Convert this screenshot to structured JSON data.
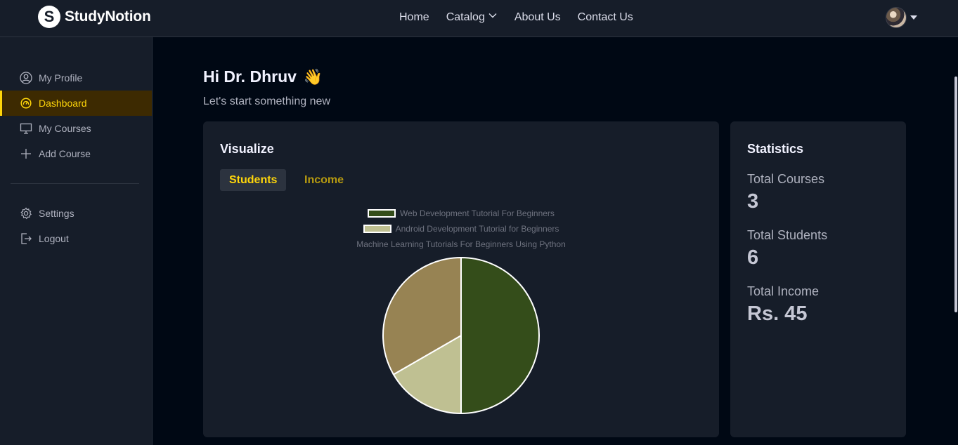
{
  "brand": {
    "name": "StudyNotion",
    "mark": "S"
  },
  "nav": {
    "links": [
      {
        "label": "Home"
      },
      {
        "label": "Catalog"
      },
      {
        "label": "About Us"
      },
      {
        "label": "Contact Us"
      }
    ]
  },
  "sidebar": {
    "items": [
      {
        "label": "My Profile",
        "icon": "user-circle-icon"
      },
      {
        "label": "Dashboard",
        "icon": "dashboard-gauge-icon",
        "active": true
      },
      {
        "label": "My Courses",
        "icon": "monitor-icon"
      },
      {
        "label": "Add Course",
        "icon": "plus-icon"
      }
    ],
    "bottom_items": [
      {
        "label": "Settings",
        "icon": "gear-icon"
      },
      {
        "label": "Logout",
        "icon": "logout-icon"
      }
    ]
  },
  "main": {
    "greeting": "Hi Dr. Dhruv",
    "greeting_emoji": "👋",
    "subtitle": "Let's start something new"
  },
  "visualize": {
    "title": "Visualize",
    "tabs": [
      {
        "label": "Students",
        "active": true
      },
      {
        "label": "Income",
        "active": false
      }
    ]
  },
  "chart_data": {
    "type": "pie",
    "title": "",
    "categories": [
      "Web Development Tutorial For Beginners",
      "Android Development Tutorial for Beginners",
      "Machine Learning Tutorials For Beginners Using Python"
    ],
    "values": [
      3,
      1,
      2
    ],
    "colors": [
      "#344d1a",
      "#bfc092",
      "#978353"
    ],
    "legend": "top-center"
  },
  "statistics": {
    "title": "Statistics",
    "items": [
      {
        "label": "Total Courses",
        "value": "3"
      },
      {
        "label": "Total Students",
        "value": "6"
      },
      {
        "label": "Total Income",
        "value": "Rs. 45"
      }
    ]
  },
  "colors": {
    "accent": "#ffd60a",
    "background": "#000814",
    "panel": "#161d29"
  }
}
